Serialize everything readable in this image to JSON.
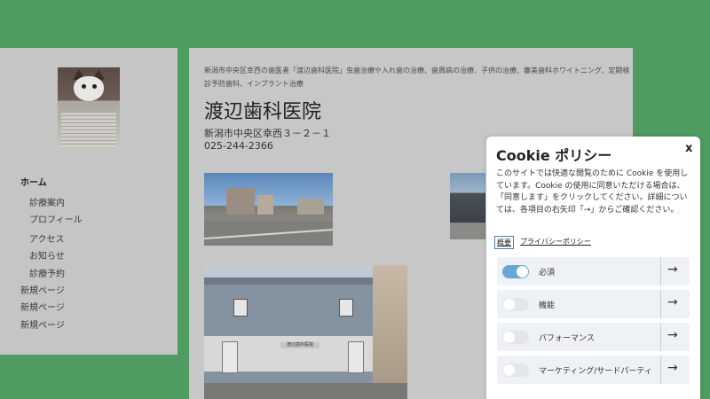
{
  "sidebar": {
    "nav": [
      {
        "label": "ホーム"
      },
      {
        "label": "診療案内"
      },
      {
        "label": "プロフィール"
      },
      {
        "label": "アクセス"
      },
      {
        "label": "お知らせ"
      },
      {
        "label": "診療予約"
      },
      {
        "label": "新規ページ"
      },
      {
        "label": "新規ページ"
      },
      {
        "label": "新規ページ"
      }
    ]
  },
  "main": {
    "description": "新潟市中央区幸西の歯医者「渡辺歯科医院」虫歯治療や入れ歯の治療、歯周病の治療、子供の治療、審美歯科ホワイトニング、定期検診予防歯科、インプラント治療",
    "clinic_name": "渡辺歯科医院",
    "address": "新潟市中央区幸西３－２－１",
    "phone": "025-244-2366",
    "building_sign": "渡辺歯科医院"
  },
  "cookie": {
    "title": "Cookie ポリシー",
    "close": "x",
    "body": "このサイトでは快適な閲覧のために Cookie を使用しています。Cookie の使用に同意いただける場合は、「同意します」をクリックしてください。詳細については、各項目の右矢印「→」からご確認ください。",
    "tab_overview": "概要",
    "privacy_link": "プライバシーポリシー",
    "categories": [
      {
        "label": "必須",
        "enabled": true,
        "arrow": "→"
      },
      {
        "label": "機能",
        "enabled": false,
        "arrow": "→"
      },
      {
        "label": "パフォーマンス",
        "enabled": false,
        "arrow": "→"
      },
      {
        "label": "マーケティング/サードパーティ",
        "enabled": false,
        "arrow": "→"
      }
    ]
  },
  "colors": {
    "background": "#4f9b62",
    "toggle_on": "#6aa6d6"
  }
}
